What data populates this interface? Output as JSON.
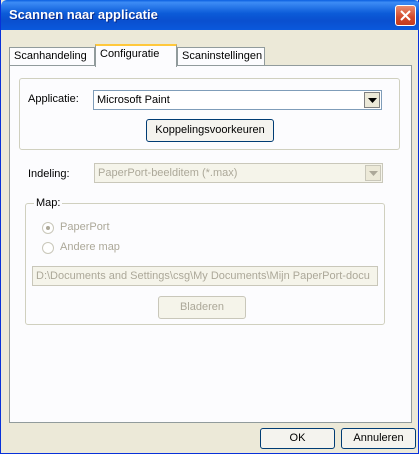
{
  "window": {
    "title": "Scannen naar applicatie"
  },
  "tabs": [
    {
      "label": "Scanhandeling"
    },
    {
      "label": "Configuratie"
    },
    {
      "label": "Scaninstellingen"
    }
  ],
  "configuratie": {
    "applicatie_label": "Applicatie:",
    "applicatie_value": "Microsoft Paint",
    "koppelings_button": "Koppelingsvoorkeuren",
    "indeling_label": "Indeling:",
    "indeling_value": "PaperPort-beelditem (*.max)",
    "map_legend": "Map:",
    "radio_paperport": "PaperPort",
    "radio_andere": "Andere map",
    "path_value": "D:\\Documents and Settings\\csg\\My Documents\\Mijn PaperPort-docu",
    "bladeren_button": "Bladeren"
  },
  "footer": {
    "ok_label": "OK",
    "annuleren_label": "Annuleren"
  },
  "colors": {
    "titlebar": "#0a58dc",
    "close_button": "#d2492b",
    "dialog_bg": "#ece9d8",
    "active_tab_accent": "#ffc83c"
  }
}
